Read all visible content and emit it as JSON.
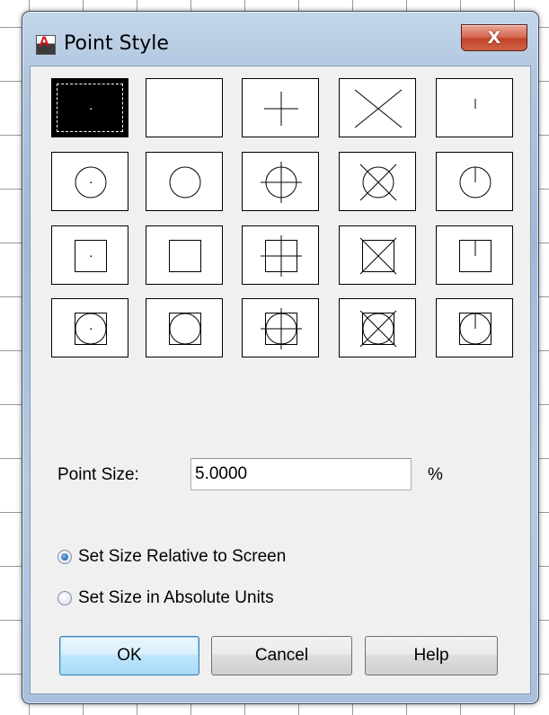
{
  "window": {
    "title": "Point Style",
    "app_icon_letter": "A",
    "close_symbol": "X"
  },
  "styles": {
    "selected_index": 0,
    "tiles": [
      "dot",
      "none",
      "plus",
      "cross",
      "tick",
      "circle-dot",
      "circle-none",
      "circle-plus",
      "circle-cross",
      "circle-tick",
      "square-dot",
      "square-none",
      "square-plus",
      "square-cross",
      "square-tick",
      "square-circle-dot",
      "square-circle-none",
      "square-circle-plus",
      "square-circle-cross",
      "square-circle-tick"
    ]
  },
  "point_size": {
    "label": "Point Size:",
    "value": "5.0000",
    "unit": "%"
  },
  "size_mode": {
    "relative_label": "Set Size Relative to Screen",
    "absolute_label": "Set Size in Absolute Units",
    "selected": "relative"
  },
  "buttons": {
    "ok": "OK",
    "cancel": "Cancel",
    "help": "Help"
  }
}
